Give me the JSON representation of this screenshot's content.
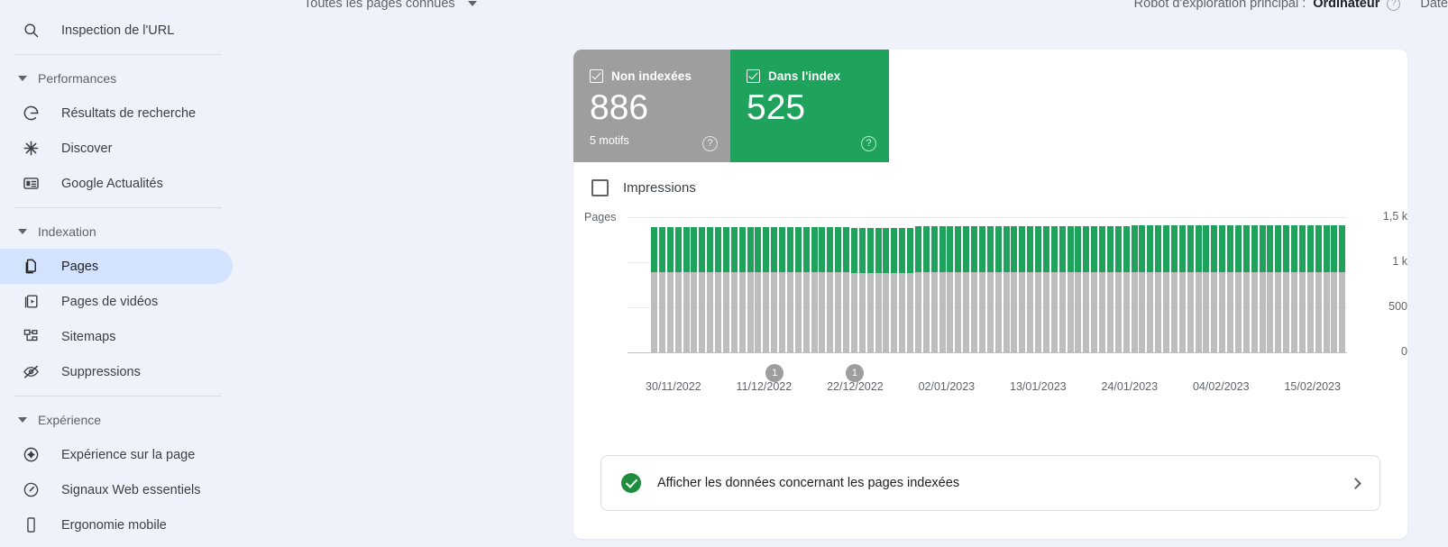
{
  "header": {
    "page_filter": "Toutes les pages connues",
    "crawler_prefix": "Robot d'exploration principal :",
    "crawler_value": "Ordinateur",
    "help_glyph": "?",
    "date_cut": "Date"
  },
  "sidebar": {
    "url_inspection": {
      "label": "Inspection de l'URL",
      "icon": "search-icon"
    },
    "sections": [
      {
        "title": "Performances",
        "items": [
          {
            "label": "Résultats de recherche",
            "icon": "google-g-icon"
          },
          {
            "label": "Discover",
            "icon": "discover-asterisk-icon"
          },
          {
            "label": "Google Actualités",
            "icon": "news-card-icon"
          }
        ]
      },
      {
        "title": "Indexation",
        "items": [
          {
            "label": "Pages",
            "icon": "pages-copy-icon",
            "selected": true
          },
          {
            "label": "Pages de vidéos",
            "icon": "video-page-icon"
          },
          {
            "label": "Sitemaps",
            "icon": "sitemap-tree-icon"
          },
          {
            "label": "Suppressions",
            "icon": "eye-off-icon"
          }
        ]
      },
      {
        "title": "Expérience",
        "items": [
          {
            "label": "Expérience sur la page",
            "icon": "page-experience-icon"
          },
          {
            "label": "Signaux Web essentiels",
            "icon": "speedometer-icon"
          },
          {
            "label": "Ergonomie mobile",
            "icon": "mobile-phone-icon"
          }
        ]
      }
    ]
  },
  "card": {
    "tiles": [
      {
        "label": "Non indexées",
        "value": "886",
        "sub": "5 motifs",
        "checked": true,
        "color": "#9e9e9e",
        "help_glyph": "?"
      },
      {
        "label": "Dans l'index",
        "value": "525",
        "sub": "",
        "checked": true,
        "color": "#1ea25c",
        "help_glyph": "?"
      }
    ],
    "impressions": {
      "label": "Impressions",
      "checked": false
    },
    "banner": {
      "text": "Afficher les données concernant les pages indexées",
      "icon": "check-circle-icon",
      "chevron": "chevron-right-icon"
    }
  },
  "chart_data": {
    "type": "bar",
    "title": "",
    "ylabel": "Pages",
    "xlabel": "",
    "stacked": true,
    "grid": true,
    "legend_position": "top",
    "ylim": [
      0,
      1500
    ],
    "ytick_labels": [
      "1,5 k",
      "1 k",
      "500",
      "0"
    ],
    "ytick_values": [
      1500,
      1000,
      500,
      0
    ],
    "xtick_labels": [
      "30/11/2022",
      "11/12/2022",
      "22/12/2022",
      "02/01/2023",
      "13/01/2023",
      "24/01/2023",
      "04/02/2023",
      "15/02/2023"
    ],
    "colors": {
      "Non indexées": "#bdbdbd",
      "Dans l'index": "#1ea25c"
    },
    "annotations": [
      {
        "label": "1",
        "x_index": 15
      },
      {
        "label": "1",
        "x_index": 25
      }
    ],
    "series": [
      {
        "name": "Non indexées",
        "color": "#bdbdbd",
        "values": [
          886,
          886,
          886,
          886,
          886,
          886,
          886,
          886,
          886,
          886,
          886,
          886,
          886,
          886,
          886,
          886,
          886,
          886,
          886,
          886,
          886,
          886,
          886,
          886,
          886,
          880,
          880,
          880,
          880,
          880,
          880,
          880,
          880,
          886,
          886,
          886,
          886,
          886,
          886,
          886,
          886,
          886,
          886,
          886,
          886,
          886,
          886,
          886,
          886,
          886,
          886,
          886,
          886,
          886,
          886,
          886,
          886,
          886,
          886,
          886,
          886,
          886,
          886,
          886,
          886,
          886,
          886,
          886,
          886,
          886,
          886,
          886,
          886,
          886,
          886,
          886,
          886,
          886,
          886,
          886,
          886,
          886,
          886,
          886,
          886,
          886,
          886
        ]
      },
      {
        "name": "Dans l'index",
        "color": "#1ea25c",
        "values": [
          500,
          500,
          500,
          500,
          500,
          500,
          500,
          500,
          500,
          500,
          500,
          500,
          500,
          500,
          500,
          500,
          500,
          500,
          500,
          500,
          500,
          500,
          500,
          500,
          500,
          505,
          505,
          505,
          505,
          505,
          505,
          505,
          505,
          510,
          510,
          510,
          510,
          510,
          510,
          510,
          510,
          510,
          510,
          515,
          515,
          515,
          515,
          515,
          515,
          515,
          515,
          515,
          515,
          515,
          515,
          518,
          518,
          518,
          518,
          518,
          520,
          520,
          520,
          520,
          520,
          520,
          520,
          520,
          522,
          522,
          522,
          522,
          522,
          522,
          525,
          525,
          525,
          525,
          525,
          525,
          525,
          525,
          525,
          525,
          525,
          525,
          525
        ]
      }
    ]
  }
}
